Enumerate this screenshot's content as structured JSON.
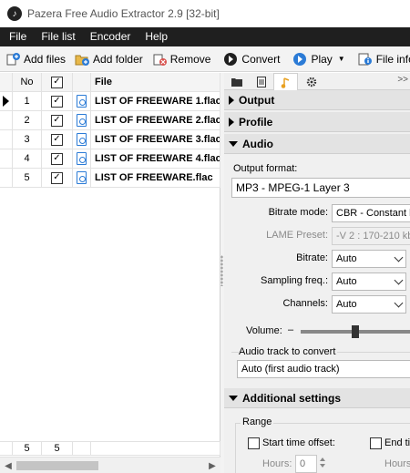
{
  "window": {
    "title": "Pazera Free Audio Extractor 2.9  [32-bit]"
  },
  "menu": [
    "File",
    "File list",
    "Encoder",
    "Help"
  ],
  "toolbar": {
    "add_files": "Add files",
    "add_folder": "Add folder",
    "remove": "Remove",
    "convert": "Convert",
    "play": "Play",
    "file_info": "File info"
  },
  "filelist": {
    "headers": {
      "no": "No",
      "file": "File"
    },
    "rows": [
      {
        "no": "1",
        "checked": true,
        "file": "LIST OF FREEWARE 1.flac"
      },
      {
        "no": "2",
        "checked": true,
        "file": "LIST OF FREEWARE 2.flac"
      },
      {
        "no": "3",
        "checked": true,
        "file": "LIST OF FREEWARE 3.flac"
      },
      {
        "no": "4",
        "checked": true,
        "file": "LIST OF FREEWARE 4.flac"
      },
      {
        "no": "5",
        "checked": true,
        "file": "LIST OF FREEWARE.flac"
      }
    ],
    "footer": {
      "count": "5",
      "checked_count": "5"
    }
  },
  "tabs": [
    "folder-icon",
    "document-icon",
    "music-note-icon",
    "gear-icon"
  ],
  "panel": {
    "sections": {
      "output": "Output",
      "profile": "Profile",
      "audio": "Audio",
      "additional": "Additional settings"
    },
    "audio": {
      "output_format_label": "Output format:",
      "output_format_value": "MP3 - MPEG-1 Layer 3",
      "bitrate_mode_label": "Bitrate mode:",
      "bitrate_mode_value": "CBR - Constant b",
      "lame_preset_label": "LAME Preset:",
      "lame_preset_value": "-V 2 : 170-210 kbi",
      "bitrate_label": "Bitrate:",
      "bitrate_value": "Auto",
      "sampling_label": "Sampling freq.:",
      "sampling_value": "Auto",
      "channels_label": "Channels:",
      "channels_value": "Auto",
      "volume_label": "Volume:",
      "volume_minus": "–",
      "volume_level": 0.5,
      "track_label": "Audio track to convert",
      "track_value": "Auto (first audio track)"
    },
    "additional": {
      "range_label": "Range",
      "start_offset_label": "Start time offset:",
      "end_label": "End ti",
      "hours_label": "Hours:",
      "hours_value": "0",
      "hours_label2": "Hours"
    }
  }
}
